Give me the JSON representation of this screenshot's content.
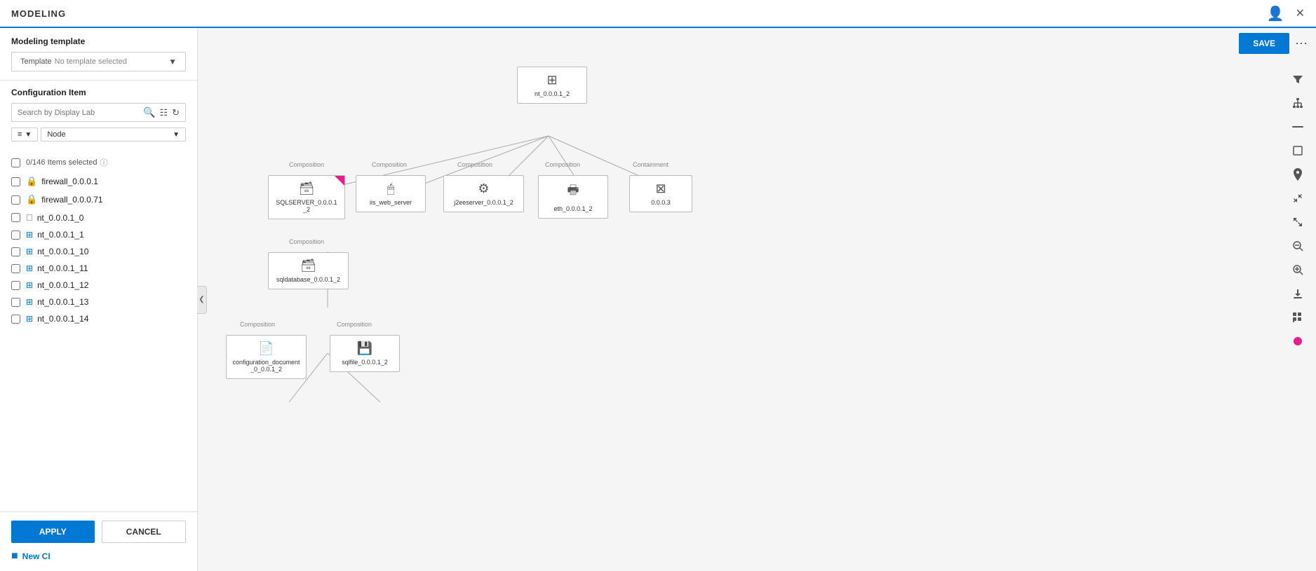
{
  "header": {
    "title": "MODELING",
    "close_label": "✕",
    "user_icon": "👤"
  },
  "sidebar": {
    "modeling_template_label": "Modeling template",
    "template_label": "Template",
    "template_value": "No template selected",
    "configuration_item_label": "Configuration Item",
    "search_placeholder": "Search by Display Lab",
    "items_count": "0/146 Items selected",
    "items_help": "?",
    "filter_label": "≡",
    "node_label": "Node",
    "list_items": [
      {
        "id": "firewall_0.0.0.1",
        "type": "lock",
        "label": "firewall_0.0.0.1"
      },
      {
        "id": "firewall_0.0.0.71",
        "type": "lock",
        "label": "firewall_0.0.0.71"
      },
      {
        "id": "nt_0.0.0.1_0",
        "type": "windows",
        "label": "nt_0.0.0.1_0"
      },
      {
        "id": "nt_0.0.0.1_1",
        "type": "windows",
        "label": "nt_0.0.0.1_1"
      },
      {
        "id": "nt_0.0.0.1_10",
        "type": "windows",
        "label": "nt_0.0.0.1_10"
      },
      {
        "id": "nt_0.0.0.1_11",
        "type": "windows",
        "label": "nt_0.0.0.1_11"
      },
      {
        "id": "nt_0.0.0.1_12",
        "type": "windows",
        "label": "nt_0.0.0.1_12"
      },
      {
        "id": "nt_0.0.0.1_13",
        "type": "windows",
        "label": "nt_0.0.0.1_13"
      },
      {
        "id": "nt_0.0.0.1_14",
        "type": "windows",
        "label": "nt_0.0.0.1_14"
      }
    ],
    "apply_label": "APPLY",
    "cancel_label": "CANCEL",
    "new_ci_label": "New CI"
  },
  "canvas": {
    "save_label": "SAVE",
    "more_label": "···",
    "nodes": {
      "root": {
        "label": "nt_0.0.0.1_2",
        "type": "windows"
      },
      "sqlserver": {
        "label": "SQLSERVER_0.0.0.1_2",
        "edge_label": "Composition",
        "type": "db"
      },
      "iis": {
        "label": "iis_web_server",
        "edge_label": "Composition",
        "type": "web"
      },
      "j2ee": {
        "label": "j2eeserver_0.0.0.1_2",
        "edge_label": "Composition",
        "type": "settings"
      },
      "eth": {
        "label": "eth_0.0.0.1_2",
        "edge_label": "Composition",
        "type": "monitor"
      },
      "solutions": {
        "label": "0.0.0.3",
        "edge_label": "Containment",
        "type": "table"
      },
      "sqldatabase": {
        "label": "sqldatabase_0.0.0.1_2",
        "edge_label": "Composition",
        "type": "db"
      },
      "config_doc": {
        "label": "configuration_document_0_0.0.1_2",
        "edge_label": "Composition",
        "type": "doc"
      },
      "sqlfile": {
        "label": "sqlfile_0.0.0.1_2",
        "edge_label": "Composition",
        "type": "file"
      }
    },
    "tools": [
      "filter",
      "hierarchy",
      "minus-line",
      "square",
      "map-pin",
      "compress",
      "expand",
      "zoom-out",
      "zoom-in",
      "download",
      "grid",
      "circle-pink"
    ]
  }
}
